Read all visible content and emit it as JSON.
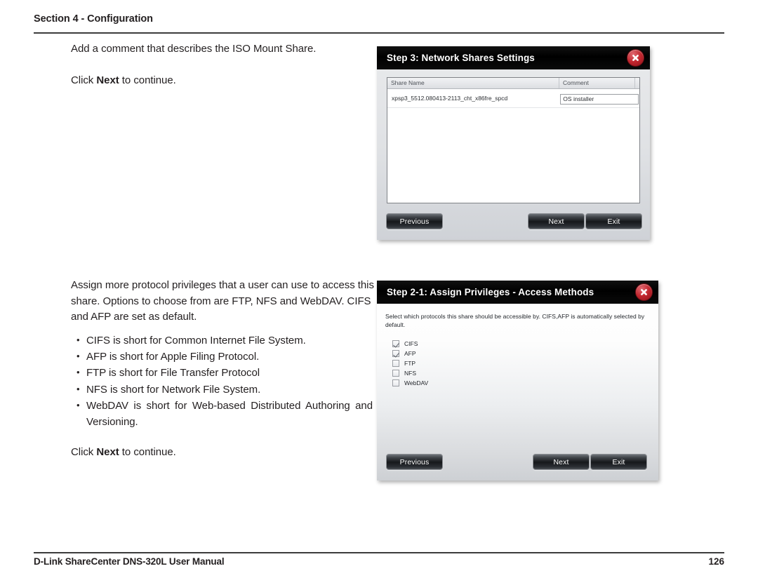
{
  "header": {
    "section_title": "Section 4 - Configuration"
  },
  "body": {
    "block1": {
      "paragraph": "Add a comment that describes the ISO Mount Share.",
      "click_prefix": "Click ",
      "click_bold": "Next",
      "click_suffix": " to continue."
    },
    "block2": {
      "paragraph": "Assign more protocol privileges that a user can use to access this share. Options to choose from are FTP, NFS and WebDAV. CIFS and AFP are set as default.",
      "bullets": [
        "CIFS is short for Common Internet File System.",
        "AFP is short for Apple Filing Protocol.",
        "FTP is short for File Transfer Protocol",
        "NFS is short for Network File System.",
        "WebDAV is short for Web-based Distributed Authoring and Versioning."
      ],
      "click_prefix": "Click ",
      "click_bold": "Next",
      "click_suffix": " to continue."
    }
  },
  "dialog_shares": {
    "title": "Step 3: Network Shares Settings",
    "close_icon": "close-x-icon",
    "columns": {
      "share_name": "Share Name",
      "comment": "Comment"
    },
    "rows": [
      {
        "share_name": "xpsp3_5512.080413-2113_cht_x86fre_spcd",
        "comment_value": "OS installer"
      }
    ],
    "buttons": {
      "previous": "Previous",
      "next": "Next",
      "exit": "Exit"
    }
  },
  "dialog_privileges": {
    "title": "Step 2-1: Assign Privileges - Access Methods",
    "close_icon": "close-x-icon",
    "instruction": "Select which protocols this share should be accessible by. CIFS,AFP is automatically selected by default.",
    "protocols": [
      {
        "label": "CIFS",
        "checked": true
      },
      {
        "label": "AFP",
        "checked": true
      },
      {
        "label": "FTP",
        "checked": false
      },
      {
        "label": "NFS",
        "checked": false
      },
      {
        "label": "WebDAV",
        "checked": false
      }
    ],
    "buttons": {
      "previous": "Previous",
      "next": "Next",
      "exit": "Exit"
    }
  },
  "footer": {
    "manual_title": "D-Link ShareCenter DNS-320L User Manual",
    "page_number": "126"
  },
  "colors": {
    "rule": "#3c3c3c",
    "titlebar": "#000000",
    "close_red": "#c2272f",
    "text": "#231f20"
  }
}
